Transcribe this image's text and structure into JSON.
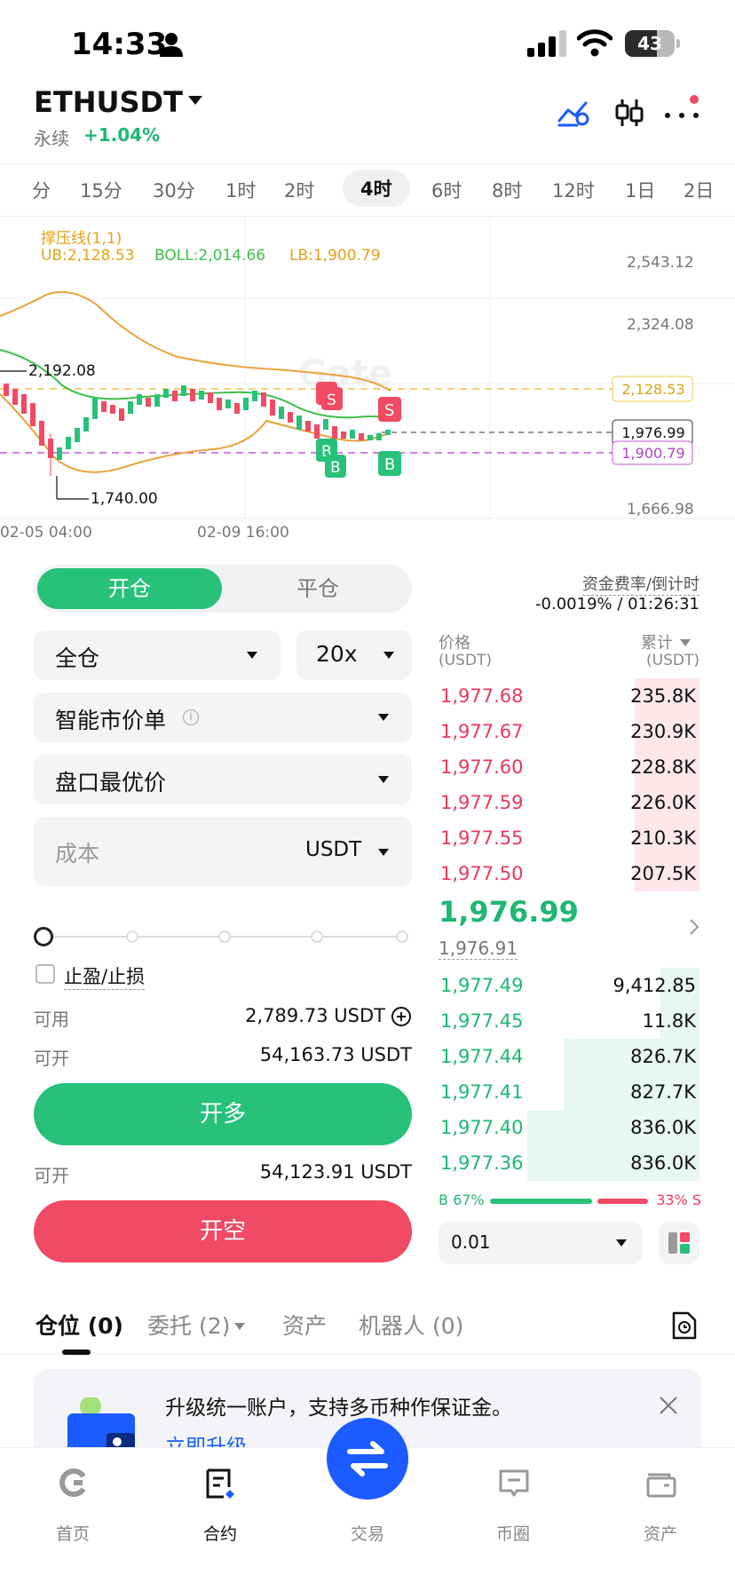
{
  "status_bar": {
    "time": "14:33",
    "battery": "43"
  },
  "header": {
    "symbol": "ETHUSDT",
    "perp_label": "永续",
    "change": "+1.04%"
  },
  "timeframes": [
    "分",
    "15分",
    "30分",
    "1时",
    "2时",
    "4时",
    "6时",
    "8时",
    "12时",
    "1日",
    "2日"
  ],
  "timeframe_active": "4时",
  "chart": {
    "indicator_title": "撑压线(1,1)",
    "ub": "UB:2,128.53",
    "boll": "BOLL:2,014.66",
    "lb": "LB:1,900.79",
    "price_axis": [
      "2,543.12",
      "2,324.08",
      "1,666.98"
    ],
    "tag_ub": "2,128.53",
    "tag_last": "1,976.99",
    "tag_lb": "1,900.79",
    "high_label": "2,192.08",
    "low_label": "1,740.00",
    "time_axis": [
      "02-05 04:00",
      "02-09 16:00"
    ],
    "watermark": "Gate",
    "buy_marker": "B",
    "sell_marker": "S"
  },
  "trade": {
    "tab_open": "开仓",
    "tab_close": "平仓",
    "margin_mode": "全仓",
    "leverage": "20x",
    "order_type": "智能市价单",
    "price_mode": "盘口最优价",
    "cost_placeholder": "成本",
    "cost_unit": "USDT",
    "tpsl_label": "止盈/止损",
    "available_label": "可用",
    "available_value": "2,789.73 USDT",
    "can_open_label": "可开",
    "can_open_long": "54,163.73 USDT",
    "long_button": "开多",
    "can_open_short": "54,123.91 USDT",
    "short_button": "开空"
  },
  "orderbook": {
    "funding_label": "资金费率/倒计时",
    "funding_value": "-0.0019% / 01:26:31",
    "col_price": "价格",
    "col_price_unit": "(USDT)",
    "col_cum": "累计",
    "col_cum_unit": "(USDT)",
    "asks": [
      {
        "price": "1,977.68",
        "amount": "235.8K",
        "depth": 0.25
      },
      {
        "price": "1,977.67",
        "amount": "230.9K",
        "depth": 0.25
      },
      {
        "price": "1,977.60",
        "amount": "228.8K",
        "depth": 0.25
      },
      {
        "price": "1,977.59",
        "amount": "226.0K",
        "depth": 0.25
      },
      {
        "price": "1,977.55",
        "amount": "210.3K",
        "depth": 0.25
      },
      {
        "price": "1,977.50",
        "amount": "207.5K",
        "depth": 0.25
      }
    ],
    "last_price": "1,976.99",
    "mark_price": "1,976.91",
    "bids": [
      {
        "price": "1,977.49",
        "amount": "9,412.85",
        "depth": 0.15
      },
      {
        "price": "1,977.45",
        "amount": "11.8K",
        "depth": 0.15
      },
      {
        "price": "1,977.44",
        "amount": "826.7K",
        "depth": 0.52
      },
      {
        "price": "1,977.41",
        "amount": "827.7K",
        "depth": 0.52
      },
      {
        "price": "1,977.40",
        "amount": "836.0K",
        "depth": 0.66
      },
      {
        "price": "1,977.36",
        "amount": "836.0K",
        "depth": 0.66
      }
    ],
    "buy_ratio": "B 67%",
    "sell_ratio": "33% S",
    "buy_ratio_value": 0.67,
    "precision": "0.01"
  },
  "positions_tabs": [
    {
      "label": "仓位 (0)"
    },
    {
      "label": "委托 (2)"
    },
    {
      "label": "资产"
    },
    {
      "label": "机器人 (0)"
    }
  ],
  "banner": {
    "text": "升级统一账户，支持多币种作保证金。",
    "link": "立即升级"
  },
  "bottom_nav": [
    {
      "label": "首页"
    },
    {
      "label": "合约"
    },
    {
      "label": "交易"
    },
    {
      "label": "币圈"
    },
    {
      "label": "资产"
    }
  ],
  "colors": {
    "green": "#27c17a",
    "red": "#f04a64",
    "accent": "#1b5bff"
  }
}
